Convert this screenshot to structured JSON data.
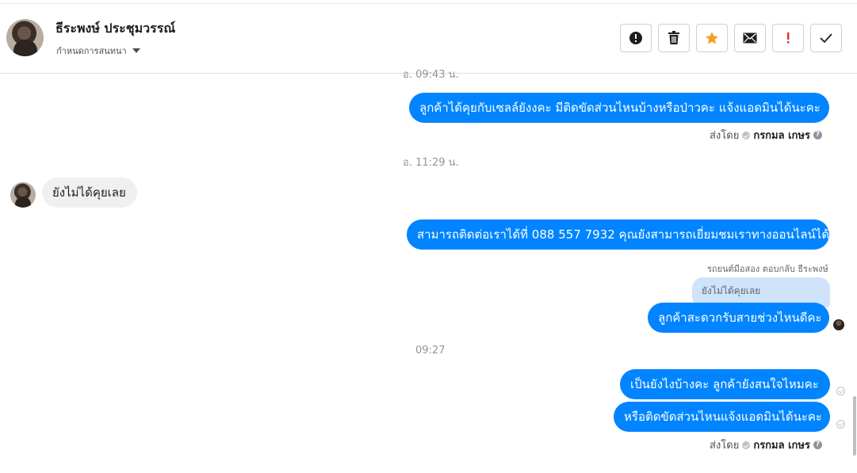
{
  "header": {
    "contact_name": "ธีระพงษ์ ประชุมวรรณ์",
    "convo_setting": "กำหนดการสนทนา",
    "toolbar": {
      "report_icon": "alert-circle-icon",
      "delete_icon": "trash-icon",
      "star_icon": "star-icon",
      "mail_icon": "envelope-icon",
      "important_icon": "exclamation-icon",
      "done_icon": "check-icon",
      "star_color": "#f79b21",
      "important_color": "#e02f2f"
    }
  },
  "messages": {
    "time_1": "อ. 09:43 น.",
    "msg_1": "ลูกค้าได้คุยกับเซลล์ยังงคะ มีติดขัดส่วนไหนบ้างหรือป่าวคะ แจ้งแอดมินได้นะคะ",
    "sentby_1_prefix": "ส่งโดย",
    "sentby_1_name": "กรกมล เกษร",
    "time_2": "อ. 11:29 น.",
    "msg_2": "ยังไม่ได้คุยเลย",
    "msg_3": "สามารถติดต่อเราได้ที่ 088 557 7932 คุณยังสามารถเยี่ยมชมเราทางออนไลน์ได้",
    "reply_note": "รถยนต์มือสอง ตอบกลับ ธีระพงษ์",
    "quoted_text": "ยังไม่ได้คุยเลย",
    "msg_4": "ลูกค้าสะดวกรับสายช่วงไหนดีคะ",
    "time_3": "09:27",
    "msg_5": "เป็นยังไงบ้างคะ ลูกค้ายังสนใจไหมคะ",
    "msg_6": "หรือติดขัดส่วนไหนแจ้งแอดมินได้นะคะ",
    "sentby_2_prefix": "ส่งโดย",
    "sentby_2_name": "กรกมล เกษร",
    "help_glyph": "?"
  },
  "colors": {
    "outgoing_bubble": "#0084ff",
    "incoming_bubble": "#f1f0f0",
    "quoted_bubble": "#cfe3fb"
  }
}
